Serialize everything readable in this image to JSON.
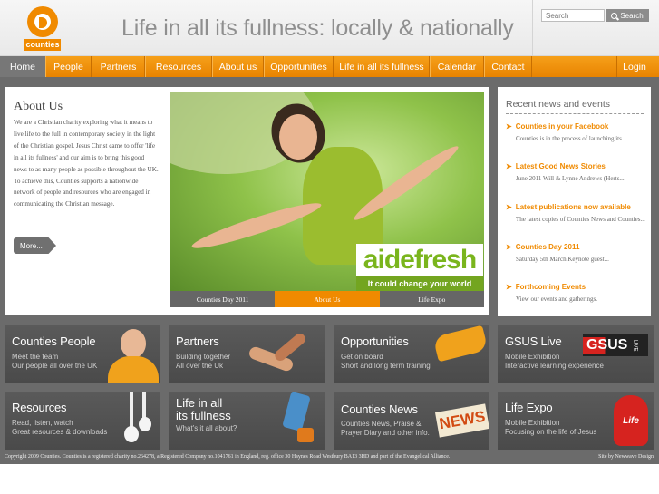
{
  "header": {
    "logo_word": "counties",
    "tagline": "Life in all its fullness: locally & nationally",
    "search": {
      "placeholder": "Search",
      "button_label": "Search"
    }
  },
  "nav": {
    "items": [
      "Home",
      "People",
      "Partners",
      "Resources",
      "About us",
      "Opportunities",
      "Life in all its fullness",
      "Calendar",
      "Contact"
    ],
    "login": "Login"
  },
  "about": {
    "title": "About Us",
    "text": "We are a Christian charity exploring what it means to live life to the full in contemporary society in the light of the Christian gospel. Jesus Christ came to offer 'life in all its fullness' and our aim is to bring this good news to as many people as possible throughout the UK.  To achieve this, Counties supports a nationwide network of people and resources who are engaged in communicating the Christian message.",
    "more_label": "More..."
  },
  "hero": {
    "brand": "aidefresh",
    "band": "It could change your world",
    "tabs": [
      "Counties Day 2011",
      "About Us",
      "Life Expo"
    ],
    "active_tab": 1
  },
  "news": {
    "title": "Recent news and events",
    "items": [
      {
        "head": "Counties in your Facebook",
        "body": "Counties is in the process of launching its..."
      },
      {
        "head": "Latest Good News Stories",
        "body": "June 2011 Will & Lynne Andrews (Herts..."
      },
      {
        "head": "Latest publications now available",
        "body": "The latest copies of Counties News and Counties..."
      },
      {
        "head": "Counties Day 2011",
        "body": "Saturday 5th March    Keynote guest..."
      },
      {
        "head": "Forthcoming Events",
        "body": "View our events and gatherings."
      }
    ]
  },
  "tiles": [
    {
      "title": "Counties People",
      "sub": [
        "Meet the team",
        "Our people all over the UK"
      ]
    },
    {
      "title": "Partners",
      "sub": [
        "Building together",
        "All over the Uk"
      ]
    },
    {
      "title": "Opportunities",
      "sub": [
        "Get on board",
        "Short and long term training"
      ]
    },
    {
      "title": "GSUS Live",
      "sub": [
        "Mobile Exhibition",
        "Interactive learning experience"
      ],
      "badge": "GSUS",
      "badge_small": "LIVE"
    },
    {
      "title": "Resources",
      "sub": [
        "Read, listen, watch",
        "Great resources & downloads"
      ]
    },
    {
      "title_lines": [
        "Life in all",
        "its fullness"
      ],
      "sub": [
        "What's it all about?"
      ]
    },
    {
      "title": "Counties News",
      "sub": [
        "Counties News, Praise &",
        "Prayer Diary and other info."
      ],
      "badge": "NEWS"
    },
    {
      "title": "Life Expo",
      "sub": [
        "Mobile Exhibition",
        "Focusing on the life of Jesus"
      ],
      "badge": "Life"
    }
  ],
  "footer": {
    "left": "Copyright 2009 Counties. Counties is a registered charity no.264278, a Registered Company no.1041761 in England, reg. office 30 Haynes Road Westbury BA13 3HD and part of the Evangelical Alliance.",
    "right": "Site by Newwave Design"
  },
  "colors": {
    "accent": "#f08a00",
    "dark_bg": "#6b6b6b",
    "tile_bg": "#555555"
  }
}
